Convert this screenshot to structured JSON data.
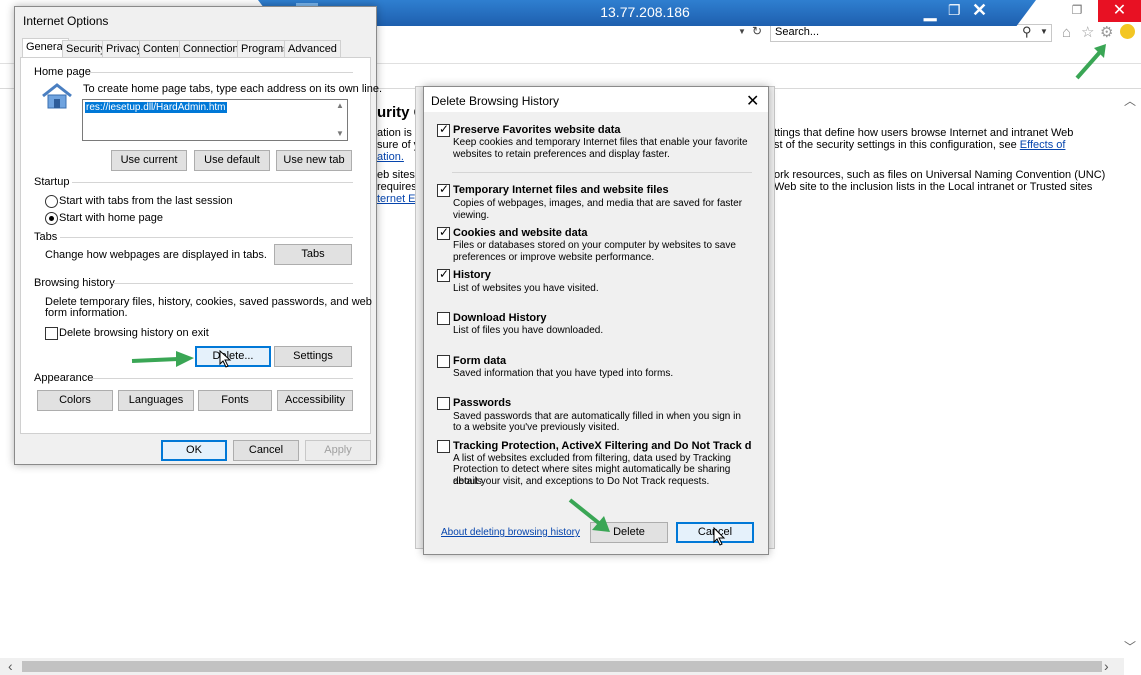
{
  "remote_session": {
    "title": "13.77.208.186"
  },
  "browser": {
    "search_placeholder": "Search...",
    "page_text": {
      "heading_fragment": "urity C",
      "left_lines": [
        "ation is c",
        "sure of y",
        "ation.",
        "eb sites",
        " requires",
        "ternet E"
      ],
      "right_line_1": "ttings that define how users browse Internet and intranet Web",
      "right_line_2a": "st of the security settings in this configuration, see ",
      "right_line_2_link": "Effects of",
      "right_line_3": "ork resources, such as files on Universal Naming Convention (UNC)",
      "right_line_4": "Web site to the inclusion lists in the Local intranet or Trusted sites"
    }
  },
  "internet_options": {
    "title": "Internet Options",
    "tabs": [
      "General",
      "Security",
      "Privacy",
      "Content",
      "Connections",
      "Programs",
      "Advanced"
    ],
    "home_page": {
      "group_label": "Home page",
      "instruction": "To create home page tabs, type each address on its own line.",
      "value": "res://iesetup.dll/HardAdmin.htm",
      "buttons": [
        "Use current",
        "Use default",
        "Use new tab"
      ]
    },
    "startup": {
      "group_label": "Startup",
      "options": [
        "Start with tabs from the last session",
        "Start with home page"
      ],
      "selected": "Start with home page"
    },
    "tabs_group": {
      "group_label": "Tabs",
      "description": "Change how webpages are displayed in tabs.",
      "button": "Tabs"
    },
    "browsing_history": {
      "group_label": "Browsing history",
      "description_line1": "Delete temporary files, history, cookies, saved passwords, and web",
      "description_line2": "form information.",
      "checkbox": "Delete browsing history on exit",
      "delete_button": "Delete...",
      "settings_button": "Settings"
    },
    "appearance": {
      "group_label": "Appearance",
      "buttons": [
        "Colors",
        "Languages",
        "Fonts",
        "Accessibility"
      ]
    },
    "footer": {
      "ok": "OK",
      "cancel": "Cancel",
      "apply": "Apply"
    }
  },
  "delete_browsing_history": {
    "title": "Delete Browsing History",
    "items": [
      {
        "title": "Preserve Favorites website data",
        "checked": true,
        "desc1": "Keep cookies and temporary Internet files that enable your favorite",
        "desc2": "websites to retain preferences and display faster."
      },
      {
        "title": "Temporary Internet files and website files",
        "checked": true,
        "desc1": "Copies of webpages, images, and media that are saved for faster",
        "desc2": "viewing."
      },
      {
        "title": "Cookies and website data",
        "checked": true,
        "desc1": "Files or databases stored on your computer by websites to save",
        "desc2": "preferences or improve website performance."
      },
      {
        "title": "History",
        "checked": true,
        "desc1": "List of websites you have visited.",
        "desc2": ""
      },
      {
        "title": "Download History",
        "checked": false,
        "desc1": "List of files you have downloaded.",
        "desc2": ""
      },
      {
        "title": "Form data",
        "checked": false,
        "desc1": "Saved information that you have typed into forms.",
        "desc2": ""
      },
      {
        "title": "Passwords",
        "checked": false,
        "desc1": "Saved passwords that are automatically filled in when you sign in",
        "desc2": "to a website you've previously visited."
      },
      {
        "title": "Tracking Protection, ActiveX Filtering and Do Not Track d",
        "checked": false,
        "desc1": "A list of websites excluded from filtering, data used by Tracking",
        "desc2": "Protection to detect where sites might automatically be sharing details",
        "desc3": "about your visit, and exceptions to Do Not Track requests."
      }
    ],
    "about_link": "About deleting browsing history",
    "delete_button": "Delete",
    "cancel_button": "Cancel"
  },
  "colors": {
    "arrow_green": "#3aa655",
    "close_red": "#e81123",
    "remote_blue": "#2f7fd0",
    "focus_blue": "#0078d7"
  }
}
